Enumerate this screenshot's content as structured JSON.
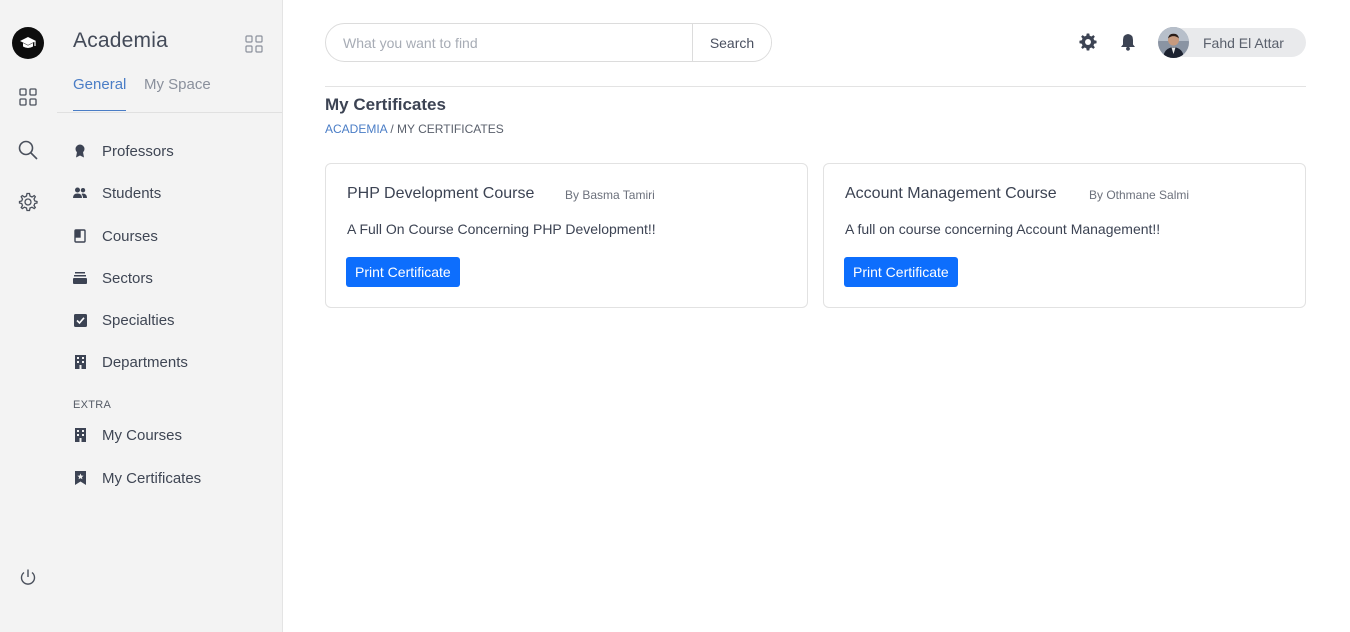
{
  "app": {
    "brand": "Academia"
  },
  "rail": {
    "icons": [
      "graduation-cap-icon",
      "grid-icon",
      "search-icon",
      "gear-icon",
      "power-icon"
    ]
  },
  "sidebar": {
    "tabs": [
      {
        "label": "General",
        "active": true
      },
      {
        "label": "My Space",
        "active": false
      }
    ],
    "items": [
      {
        "label": "Professors",
        "icon": "award-icon"
      },
      {
        "label": "Students",
        "icon": "people-icon"
      },
      {
        "label": "Courses",
        "icon": "journal-icon"
      },
      {
        "label": "Sectors",
        "icon": "stack-icon"
      },
      {
        "label": "Specialties",
        "icon": "checkbox-icon"
      },
      {
        "label": "Departments",
        "icon": "building-icon"
      }
    ],
    "extra_label": "EXTRA",
    "extra_items": [
      {
        "label": "My Courses",
        "icon": "building-icon"
      },
      {
        "label": "My Certificates",
        "icon": "bookmark-icon"
      }
    ]
  },
  "header": {
    "search_placeholder": "What you want to find",
    "search_value": "",
    "search_button": "Search",
    "user_name": "Fahd El Attar"
  },
  "page": {
    "title": "My Certificates",
    "breadcrumb_root": "ACADEMIA",
    "breadcrumb_current": " / MY CERTIFICATES"
  },
  "certificates": [
    {
      "title": "PHP Development Course",
      "author": "By Basma Tamiri",
      "description": "A Full On Course Concerning PHP Development!!",
      "button": "Print Certificate"
    },
    {
      "title": "Account Management Course",
      "author": "By Othmane Salmi",
      "description": "A full on course concerning Account Management!!",
      "button": "Print Certificate"
    }
  ],
  "colors": {
    "accent": "#4a7dc6",
    "primary_button": "#0d6efd",
    "sidebar_bg": "#f3f3f3"
  }
}
